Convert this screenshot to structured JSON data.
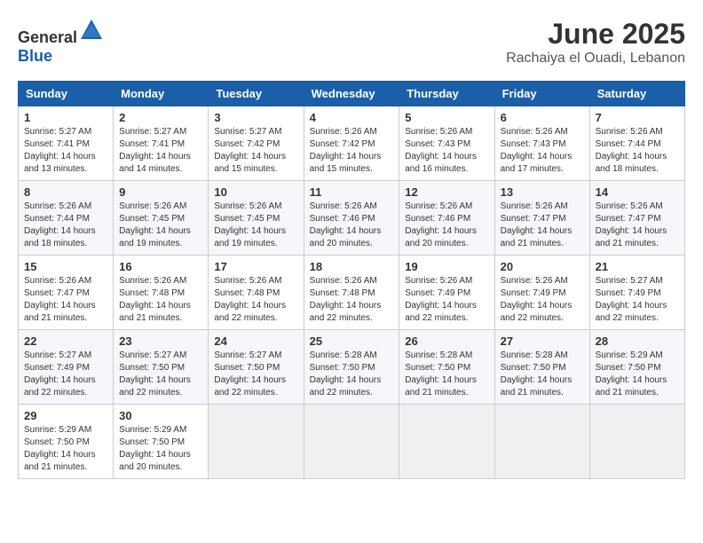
{
  "header": {
    "logo_general": "General",
    "logo_blue": "Blue",
    "month_title": "June 2025",
    "location": "Rachaiya el Ouadi, Lebanon"
  },
  "calendar": {
    "days_of_week": [
      "Sunday",
      "Monday",
      "Tuesday",
      "Wednesday",
      "Thursday",
      "Friday",
      "Saturday"
    ],
    "weeks": [
      [
        null,
        {
          "day": "2",
          "sunrise": "5:27 AM",
          "sunset": "7:41 PM",
          "daylight": "14 hours and 14 minutes."
        },
        {
          "day": "3",
          "sunrise": "5:27 AM",
          "sunset": "7:42 PM",
          "daylight": "14 hours and 15 minutes."
        },
        {
          "day": "4",
          "sunrise": "5:26 AM",
          "sunset": "7:42 PM",
          "daylight": "14 hours and 15 minutes."
        },
        {
          "day": "5",
          "sunrise": "5:26 AM",
          "sunset": "7:43 PM",
          "daylight": "14 hours and 16 minutes."
        },
        {
          "day": "6",
          "sunrise": "5:26 AM",
          "sunset": "7:43 PM",
          "daylight": "14 hours and 17 minutes."
        },
        {
          "day": "7",
          "sunrise": "5:26 AM",
          "sunset": "7:44 PM",
          "daylight": "14 hours and 18 minutes."
        }
      ],
      [
        {
          "day": "8",
          "sunrise": "5:26 AM",
          "sunset": "7:44 PM",
          "daylight": "14 hours and 18 minutes."
        },
        {
          "day": "9",
          "sunrise": "5:26 AM",
          "sunset": "7:45 PM",
          "daylight": "14 hours and 19 minutes."
        },
        {
          "day": "10",
          "sunrise": "5:26 AM",
          "sunset": "7:45 PM",
          "daylight": "14 hours and 19 minutes."
        },
        {
          "day": "11",
          "sunrise": "5:26 AM",
          "sunset": "7:46 PM",
          "daylight": "14 hours and 20 minutes."
        },
        {
          "day": "12",
          "sunrise": "5:26 AM",
          "sunset": "7:46 PM",
          "daylight": "14 hours and 20 minutes."
        },
        {
          "day": "13",
          "sunrise": "5:26 AM",
          "sunset": "7:47 PM",
          "daylight": "14 hours and 21 minutes."
        },
        {
          "day": "14",
          "sunrise": "5:26 AM",
          "sunset": "7:47 PM",
          "daylight": "14 hours and 21 minutes."
        }
      ],
      [
        {
          "day": "15",
          "sunrise": "5:26 AM",
          "sunset": "7:47 PM",
          "daylight": "14 hours and 21 minutes."
        },
        {
          "day": "16",
          "sunrise": "5:26 AM",
          "sunset": "7:48 PM",
          "daylight": "14 hours and 21 minutes."
        },
        {
          "day": "17",
          "sunrise": "5:26 AM",
          "sunset": "7:48 PM",
          "daylight": "14 hours and 22 minutes."
        },
        {
          "day": "18",
          "sunrise": "5:26 AM",
          "sunset": "7:48 PM",
          "daylight": "14 hours and 22 minutes."
        },
        {
          "day": "19",
          "sunrise": "5:26 AM",
          "sunset": "7:49 PM",
          "daylight": "14 hours and 22 minutes."
        },
        {
          "day": "20",
          "sunrise": "5:26 AM",
          "sunset": "7:49 PM",
          "daylight": "14 hours and 22 minutes."
        },
        {
          "day": "21",
          "sunrise": "5:27 AM",
          "sunset": "7:49 PM",
          "daylight": "14 hours and 22 minutes."
        }
      ],
      [
        {
          "day": "22",
          "sunrise": "5:27 AM",
          "sunset": "7:49 PM",
          "daylight": "14 hours and 22 minutes."
        },
        {
          "day": "23",
          "sunrise": "5:27 AM",
          "sunset": "7:50 PM",
          "daylight": "14 hours and 22 minutes."
        },
        {
          "day": "24",
          "sunrise": "5:27 AM",
          "sunset": "7:50 PM",
          "daylight": "14 hours and 22 minutes."
        },
        {
          "day": "25",
          "sunrise": "5:28 AM",
          "sunset": "7:50 PM",
          "daylight": "14 hours and 22 minutes."
        },
        {
          "day": "26",
          "sunrise": "5:28 AM",
          "sunset": "7:50 PM",
          "daylight": "14 hours and 21 minutes."
        },
        {
          "day": "27",
          "sunrise": "5:28 AM",
          "sunset": "7:50 PM",
          "daylight": "14 hours and 21 minutes."
        },
        {
          "day": "28",
          "sunrise": "5:29 AM",
          "sunset": "7:50 PM",
          "daylight": "14 hours and 21 minutes."
        }
      ],
      [
        {
          "day": "29",
          "sunrise": "5:29 AM",
          "sunset": "7:50 PM",
          "daylight": "14 hours and 21 minutes."
        },
        {
          "day": "30",
          "sunrise": "5:29 AM",
          "sunset": "7:50 PM",
          "daylight": "14 hours and 20 minutes."
        },
        null,
        null,
        null,
        null,
        null
      ]
    ],
    "week1_day1": {
      "day": "1",
      "sunrise": "5:27 AM",
      "sunset": "7:41 PM",
      "daylight": "14 hours and 13 minutes."
    }
  }
}
